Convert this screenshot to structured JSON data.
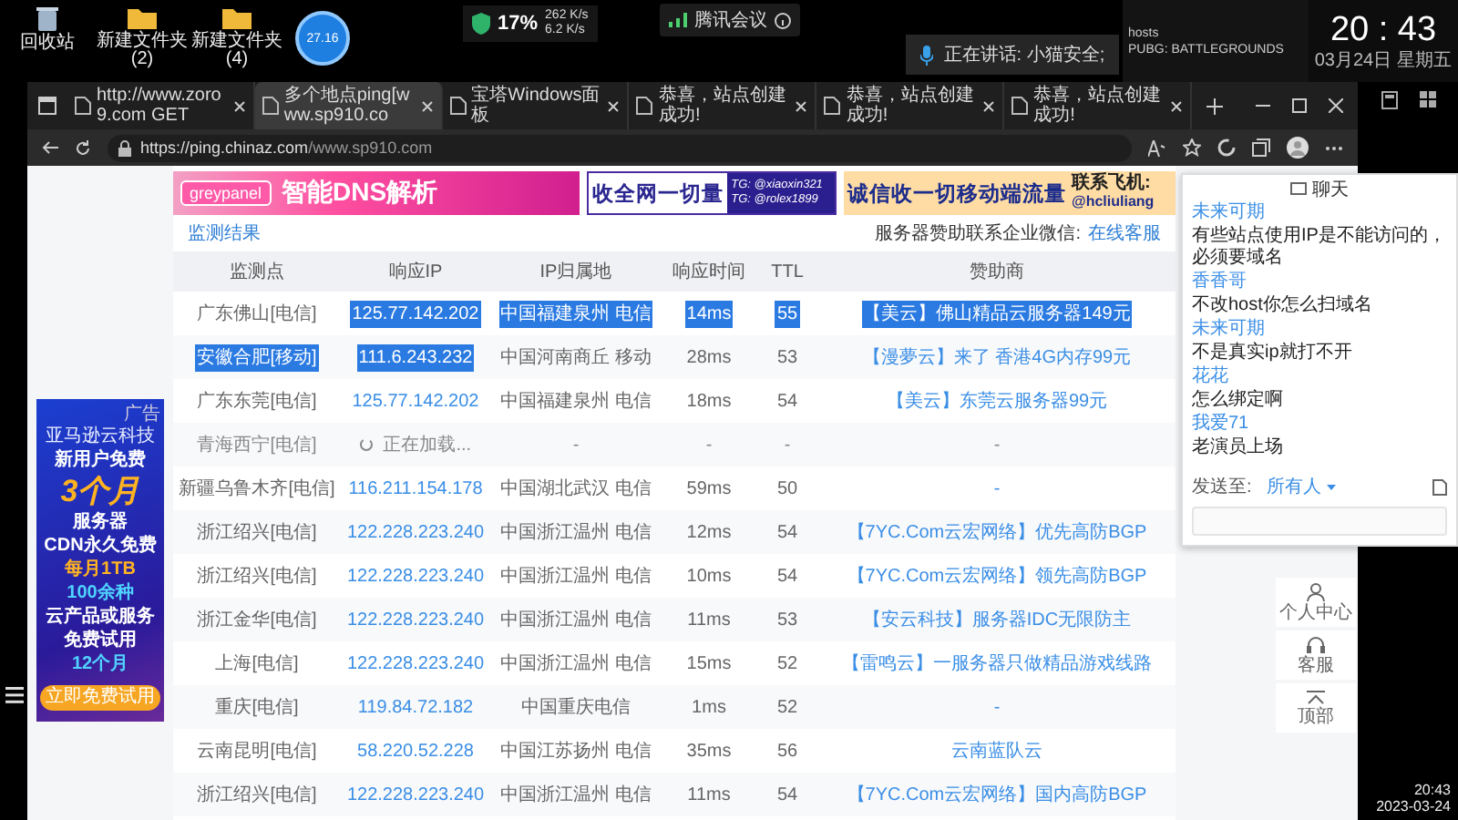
{
  "desktop": {
    "icons": [
      {
        "label": "回收站",
        "kind": "bin"
      },
      {
        "label": "新建文件夹 (2)",
        "kind": "folder"
      },
      {
        "label": "新建文件夹 (4)",
        "kind": "folder"
      }
    ],
    "badge": "27.16"
  },
  "net_widget": {
    "cpu": "17%",
    "up": "262 K/s",
    "down": "6.2 K/s"
  },
  "meeting": {
    "title": "腾讯会议",
    "speaking": "正在讲话: 小猫安全;"
  },
  "search_panel": {
    "items": [
      "hosts",
      "PUBG: BATTLEGROUNDS"
    ]
  },
  "clock_widget": {
    "time": "20 : 43",
    "date": "03月24日",
    "weekday": "星期五"
  },
  "browser": {
    "tabs": [
      {
        "title": "http://www.zoro9.com GET",
        "selected": false
      },
      {
        "title": "多个地点ping[www.sp910.co",
        "selected": true
      },
      {
        "title": "宝塔Windows面板",
        "selected": false
      },
      {
        "title": "恭喜，站点创建成功!",
        "selected": false
      },
      {
        "title": "恭喜，站点创建成功!",
        "selected": false
      },
      {
        "title": "恭喜，站点创建成功!",
        "selected": false
      }
    ],
    "url_host": "https://ping.chinaz.com",
    "url_path": "/www.sp910.com"
  },
  "page": {
    "banners": [
      {
        "kind": "dns",
        "brand": "greypanel",
        "text": "智能DNS解析"
      },
      {
        "kind": "traffic",
        "text": "收全网一切量",
        "contacts": [
          "TG: @xiaoxin321",
          "TG: @rolex1899"
        ]
      },
      {
        "kind": "mobile",
        "text": "诚信收一切移动端流量",
        "contact_label": "联系飞机:",
        "contact": "@hcliuliang"
      }
    ],
    "section_title": "监测结果",
    "sponsor_label": "服务器赞助联系企业微信:",
    "sponsor_link": "在线客服",
    "table": {
      "columns": [
        "监测点",
        "响应IP",
        "IP归属地",
        "响应时间",
        "TTL",
        "赞助商"
      ],
      "rows": [
        {
          "loading": false,
          "cells": [
            {
              "text": "广东佛山[电信]",
              "highlighted": false
            },
            {
              "text": "125.77.142.202",
              "highlighted": true
            },
            {
              "text": "中国福建泉州 电信",
              "highlighted": true
            },
            {
              "text": "14ms",
              "highlighted": true
            },
            {
              "text": "55",
              "highlighted": true
            },
            {
              "text": "【美云】佛山精品云服务器149元",
              "highlighted": true
            }
          ]
        },
        {
          "loading": false,
          "cells": [
            {
              "text": "安徽合肥[移动]",
              "highlighted": true
            },
            {
              "text": "111.6.243.232",
              "highlighted": true
            },
            {
              "text": "中国河南商丘 移动",
              "highlighted": false
            },
            {
              "text": "28ms",
              "highlighted": false
            },
            {
              "text": "53",
              "highlighted": false
            },
            {
              "text": "【漫夢云】来了 香港4G内存99元",
              "highlighted": false
            }
          ]
        },
        {
          "loading": false,
          "cells": [
            {
              "text": "广东东莞[电信]",
              "highlighted": false
            },
            {
              "text": "125.77.142.202",
              "highlighted": false
            },
            {
              "text": "中国福建泉州 电信",
              "highlighted": false
            },
            {
              "text": "18ms",
              "highlighted": false
            },
            {
              "text": "54",
              "highlighted": false
            },
            {
              "text": "【美云】东莞云服务器99元",
              "highlighted": false
            }
          ]
        },
        {
          "loading": true,
          "cells": [
            {
              "text": "青海西宁[电信]",
              "highlighted": false
            },
            {
              "text": "正在加载...",
              "highlighted": false
            },
            {
              "text": "-",
              "highlighted": false
            },
            {
              "text": "-",
              "highlighted": false
            },
            {
              "text": "-",
              "highlighted": false
            },
            {
              "text": "-",
              "highlighted": false
            }
          ]
        },
        {
          "loading": false,
          "cells": [
            {
              "text": "新疆乌鲁木齐[电信]",
              "highlighted": false
            },
            {
              "text": "116.211.154.178",
              "highlighted": false
            },
            {
              "text": "中国湖北武汉 电信",
              "highlighted": false
            },
            {
              "text": "59ms",
              "highlighted": false
            },
            {
              "text": "50",
              "highlighted": false
            },
            {
              "text": "-",
              "highlighted": false
            }
          ]
        },
        {
          "loading": false,
          "cells": [
            {
              "text": "浙江绍兴[电信]",
              "highlighted": false
            },
            {
              "text": "122.228.223.240",
              "highlighted": false
            },
            {
              "text": "中国浙江温州 电信",
              "highlighted": false
            },
            {
              "text": "12ms",
              "highlighted": false
            },
            {
              "text": "54",
              "highlighted": false
            },
            {
              "text": "【7YC.Com云宏网络】优先高防BGP",
              "highlighted": false
            }
          ]
        },
        {
          "loading": false,
          "cells": [
            {
              "text": "浙江绍兴[电信]",
              "highlighted": false
            },
            {
              "text": "122.228.223.240",
              "highlighted": false
            },
            {
              "text": "中国浙江温州 电信",
              "highlighted": false
            },
            {
              "text": "10ms",
              "highlighted": false
            },
            {
              "text": "54",
              "highlighted": false
            },
            {
              "text": "【7YC.Com云宏网络】领先高防BGP",
              "highlighted": false
            }
          ]
        },
        {
          "loading": false,
          "cells": [
            {
              "text": "浙江金华[电信]",
              "highlighted": false
            },
            {
              "text": "122.228.223.240",
              "highlighted": false
            },
            {
              "text": "中国浙江温州 电信",
              "highlighted": false
            },
            {
              "text": "11ms",
              "highlighted": false
            },
            {
              "text": "53",
              "highlighted": false
            },
            {
              "text": "【安云科技】服务器IDC无限防主",
              "highlighted": false
            }
          ]
        },
        {
          "loading": false,
          "cells": [
            {
              "text": "上海[电信]",
              "highlighted": false
            },
            {
              "text": "122.228.223.240",
              "highlighted": false
            },
            {
              "text": "中国浙江温州 电信",
              "highlighted": false
            },
            {
              "text": "15ms",
              "highlighted": false
            },
            {
              "text": "52",
              "highlighted": false
            },
            {
              "text": "【雷鸣云】一服务器只做精品游戏线路",
              "highlighted": false
            }
          ]
        },
        {
          "loading": false,
          "cells": [
            {
              "text": "重庆[电信]",
              "highlighted": false
            },
            {
              "text": "119.84.72.182",
              "highlighted": false
            },
            {
              "text": "中国重庆电信",
              "highlighted": false
            },
            {
              "text": "1ms",
              "highlighted": false
            },
            {
              "text": "52",
              "highlighted": false
            },
            {
              "text": "-",
              "highlighted": false
            }
          ]
        },
        {
          "loading": false,
          "cells": [
            {
              "text": "云南昆明[电信]",
              "highlighted": false
            },
            {
              "text": "58.220.52.228",
              "highlighted": false
            },
            {
              "text": "中国江苏扬州 电信",
              "highlighted": false
            },
            {
              "text": "35ms",
              "highlighted": false
            },
            {
              "text": "56",
              "highlighted": false
            },
            {
              "text": "云南蓝队云",
              "highlighted": false
            }
          ]
        },
        {
          "loading": false,
          "cells": [
            {
              "text": "浙江绍兴[电信]",
              "highlighted": false
            },
            {
              "text": "122.228.223.240",
              "highlighted": false
            },
            {
              "text": "中国浙江温州 电信",
              "highlighted": false
            },
            {
              "text": "11ms",
              "highlighted": false
            },
            {
              "text": "54",
              "highlighted": false
            },
            {
              "text": "【7YC.Com云宏网络】国内高防BGP",
              "highlighted": false
            }
          ]
        }
      ]
    },
    "left_ad": {
      "tag": "广告",
      "brand": "亚马逊云科技",
      "lines": [
        "新用户免费",
        "3个月",
        "服务器",
        "CDN永久免费",
        "每月1TB",
        "100余种",
        "云产品或服务",
        "免费试用",
        "12个月"
      ],
      "button": "立即免费试用"
    },
    "side_buttons": [
      {
        "label": "个人中心",
        "kind": "user"
      },
      {
        "label": "客服",
        "kind": "headset"
      },
      {
        "label": "顶部",
        "kind": "top"
      }
    ]
  },
  "chat": {
    "title": "聊天",
    "messages": [
      {
        "user": "未来可期",
        "text": "有些站点使用IP是不能访问的，必须要域名"
      },
      {
        "user": "香香哥",
        "text": "不改host你怎么扫域名"
      },
      {
        "user": "未来可期",
        "text": "不是真实ip就打不开"
      },
      {
        "user": "花花",
        "text": "怎么绑定啊"
      },
      {
        "user": "我爱71",
        "text": "老演员上场"
      }
    ],
    "send_to_label": "发送至:",
    "send_to": "所有人"
  },
  "taskbar_clock": {
    "time": "20:43",
    "date": "2023-03-24"
  }
}
